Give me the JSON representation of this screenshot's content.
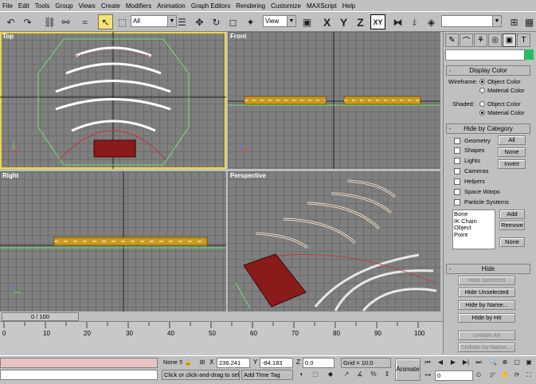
{
  "menu": [
    "File",
    "Edit",
    "Tools",
    "Group",
    "Views",
    "Create",
    "Modifiers",
    "Animation",
    "Graph Editors",
    "Rendering",
    "Customize",
    "MAXScript",
    "Help"
  ],
  "toolbar": {
    "selection_filter": "All",
    "reference_coord": "View",
    "axis_x": "X",
    "axis_y": "Y",
    "axis_z": "Z",
    "axis_xy": "XY"
  },
  "viewports": {
    "top": "Top",
    "front": "Front",
    "right": "Right",
    "perspective": "Perspective"
  },
  "panel": {
    "display_color": {
      "title": "Display Color",
      "wireframe_label": "Wireframe:",
      "wireframe_options": [
        "Object Color",
        "Material Color"
      ],
      "wireframe_selected": "Object Color",
      "shaded_label": "Shaded:",
      "shaded_options": [
        "Object Color",
        "Material Color"
      ],
      "shaded_selected": "Material Color"
    },
    "hide_by_category": {
      "title": "Hide by Category",
      "categories": [
        "Geometry",
        "Shapes",
        "Lights",
        "Cameras",
        "Helpers",
        "Space Warps",
        "Particle Systems"
      ],
      "btn_all": "All",
      "btn_none": "None",
      "btn_invert": "Invert",
      "list": [
        "Bone",
        "IK Chain Object",
        "Point"
      ],
      "btn_add": "Add",
      "btn_remove": "Remove",
      "btn_none2": "None"
    },
    "hide": {
      "title": "Hide",
      "buttons": [
        "Hide Selected",
        "Hide Unselected",
        "Hide by Name...",
        "Hide by Hit",
        "Unhide All",
        "Unhide by Name..."
      ]
    }
  },
  "timeline": {
    "frame_display": "0 / 100",
    "ticks": [
      "0",
      "10",
      "20",
      "30",
      "40",
      "50",
      "60",
      "70",
      "80",
      "90",
      "100"
    ]
  },
  "status": {
    "selection": "None S",
    "x_label": "X",
    "x_value": "236.241",
    "y_label": "Y",
    "y_value": "-84.183",
    "z_label": "Z",
    "z_value": "0.0",
    "grid": "Grid = 10.0",
    "prompt": "Click or click-and-drag to selec",
    "add_time_tag": "Add Time Tag",
    "animate": "Animate",
    "frame": "0"
  }
}
